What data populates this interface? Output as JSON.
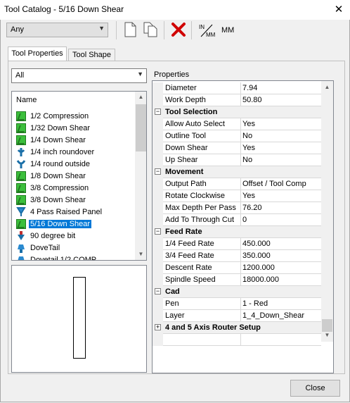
{
  "window": {
    "title": "Tool Catalog - 5/16 Down Shear"
  },
  "toolbar": {
    "filter_value": "Any",
    "inch_mm_label": [
      "IN",
      "MM"
    ],
    "mm_label": "MM"
  },
  "tabs": [
    "Tool Properties",
    "Tool Shape"
  ],
  "left": {
    "category_filter": "All",
    "list_header": "Name",
    "tools": [
      {
        "label": "1/2 Compression",
        "icon": "green-tool-icon"
      },
      {
        "label": "1/32 Down Shear",
        "icon": "green-tool-icon"
      },
      {
        "label": "1/4 Down Shear",
        "icon": "green-tool-icon"
      },
      {
        "label": "1/4 inch roundover",
        "icon": "roundover-tool-icon"
      },
      {
        "label": "1/4 round outside",
        "icon": "round-tool-icon"
      },
      {
        "label": "1/8 Down Shear",
        "icon": "green-tool-icon"
      },
      {
        "label": "3/8 Compression",
        "icon": "green-tool-icon"
      },
      {
        "label": "3/8 Down Shear",
        "icon": "green-tool-icon"
      },
      {
        "label": "4 Pass Raised Panel",
        "icon": "panel-tool-icon"
      },
      {
        "label": "5/16 Down Shear",
        "icon": "green-tool-icon",
        "selected": true
      },
      {
        "label": "90 degree bit",
        "icon": "vbit-tool-icon"
      },
      {
        "label": "DoveTail",
        "icon": "dovetail-tool-icon"
      },
      {
        "label": "Dovetail 1/2 COMP",
        "icon": "dovetail-tool-icon"
      }
    ]
  },
  "properties": {
    "label": "Properties",
    "rows": [
      {
        "type": "prop",
        "name": "Diameter",
        "value": "7.94"
      },
      {
        "type": "prop",
        "name": "Work Depth",
        "value": "50.80"
      },
      {
        "type": "cat",
        "name": "Tool Selection",
        "expander": "−"
      },
      {
        "type": "prop",
        "name": "Allow Auto Select",
        "value": "Yes"
      },
      {
        "type": "prop",
        "name": "Outline Tool",
        "value": "No"
      },
      {
        "type": "prop",
        "name": "Down Shear",
        "value": "Yes"
      },
      {
        "type": "prop",
        "name": "Up Shear",
        "value": "No"
      },
      {
        "type": "cat",
        "name": "Movement",
        "expander": "−"
      },
      {
        "type": "prop",
        "name": "Output Path",
        "value": "Offset / Tool Comp"
      },
      {
        "type": "prop",
        "name": "Rotate Clockwise",
        "value": "Yes"
      },
      {
        "type": "prop",
        "name": "Max Depth Per Pass",
        "value": "76.20"
      },
      {
        "type": "prop",
        "name": "Add To Through Cut",
        "value": "0"
      },
      {
        "type": "cat",
        "name": "Feed Rate",
        "expander": "−"
      },
      {
        "type": "prop",
        "name": "1/4 Feed Rate",
        "value": "450.000"
      },
      {
        "type": "prop",
        "name": "3/4 Feed Rate",
        "value": "350.000"
      },
      {
        "type": "prop",
        "name": "Descent Rate",
        "value": "1200.000"
      },
      {
        "type": "prop",
        "name": "Spindle Speed",
        "value": "18000.000"
      },
      {
        "type": "cat",
        "name": "Cad",
        "expander": "−"
      },
      {
        "type": "prop",
        "name": "Pen",
        "value": "1 - Red"
      },
      {
        "type": "prop",
        "name": "Layer",
        "value": "1_4_Down_Shear"
      },
      {
        "type": "cat",
        "name": "4 and 5 Axis Router Setup",
        "expander": "+"
      },
      {
        "type": "empty",
        "name": "",
        "value": ""
      }
    ]
  },
  "footer": {
    "close_label": "Close"
  },
  "colors": {
    "selection": "#0078d7",
    "delete_icon": "#d00000",
    "tool_icon": "#3cbf3c"
  }
}
